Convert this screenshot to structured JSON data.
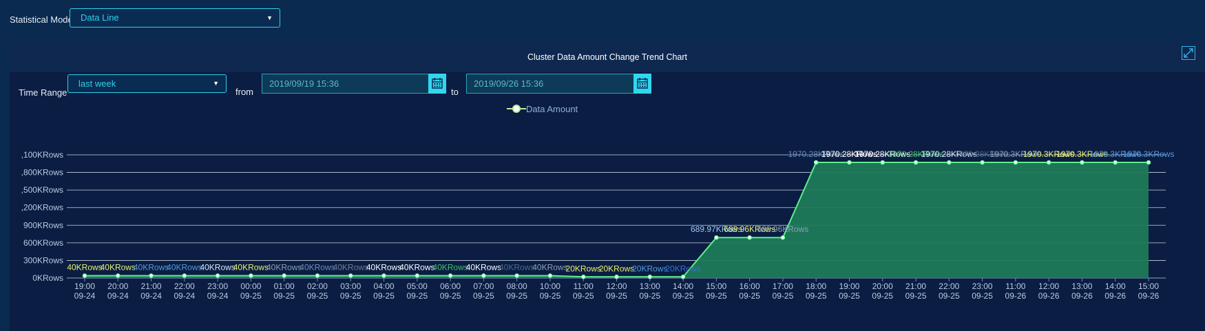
{
  "top": {
    "mode_label": "Statistical Mode",
    "mode_value": "Data Line"
  },
  "panel": {
    "title": "Cluster Data Amount Change Trend Chart",
    "time_range_label": "Time Range",
    "time_range_value": "last week",
    "from_label": "from",
    "from_value": "2019/09/19 15:36",
    "to_label": "to",
    "to_value": "2019/09/26 15:36"
  },
  "chart_data": {
    "type": "area",
    "legend": [
      "Data Amount"
    ],
    "legend_position": "top-center",
    "grid": true,
    "y_tick_labels": [
      "0KRows",
      "300KRows",
      "600KRows",
      "900KRows",
      ",200KRows",
      ",500KRows",
      ",800KRows",
      ",100KRows"
    ],
    "x_labels": [
      [
        "19:00",
        "09-24"
      ],
      [
        "20:00",
        "09-24"
      ],
      [
        "21:00",
        "09-24"
      ],
      [
        "22:00",
        "09-24"
      ],
      [
        "23:00",
        "09-24"
      ],
      [
        "00:00",
        "09-25"
      ],
      [
        "01:00",
        "09-25"
      ],
      [
        "02:00",
        "09-25"
      ],
      [
        "03:00",
        "09-25"
      ],
      [
        "04:00",
        "09-25"
      ],
      [
        "05:00",
        "09-25"
      ],
      [
        "06:00",
        "09-25"
      ],
      [
        "07:00",
        "09-25"
      ],
      [
        "08:00",
        "09-25"
      ],
      [
        "10:00",
        "09-25"
      ],
      [
        "11:00",
        "09-25"
      ],
      [
        "12:00",
        "09-25"
      ],
      [
        "13:00",
        "09-25"
      ],
      [
        "14:00",
        "09-25"
      ],
      [
        "15:00",
        "09-25"
      ],
      [
        "16:00",
        "09-25"
      ],
      [
        "17:00",
        "09-25"
      ],
      [
        "18:00",
        "09-25"
      ],
      [
        "19:00",
        "09-25"
      ],
      [
        "20:00",
        "09-25"
      ],
      [
        "21:00",
        "09-25"
      ],
      [
        "22:00",
        "09-25"
      ],
      [
        "23:00",
        "09-25"
      ],
      [
        "11:00",
        "09-26"
      ],
      [
        "12:00",
        "09-26"
      ],
      [
        "13:00",
        "09-26"
      ],
      [
        "14:00",
        "09-26"
      ],
      [
        "15:00",
        "09-26"
      ]
    ],
    "ylim": [
      0,
      2100
    ],
    "values": [
      40,
      40,
      40,
      40,
      40,
      40,
      40,
      40,
      40,
      40,
      40,
      40,
      40,
      40,
      40,
      20,
      20,
      20,
      20,
      689.97,
      689.96,
      689.96,
      1970.28,
      1970.28,
      1970.28,
      1970.28,
      1970.28,
      1970.28,
      1970.3,
      1970.3,
      1970.3,
      1970.3,
      1970.3
    ],
    "data_labels": [
      "40KRows",
      "40KRows",
      "40KRows",
      "40KRows",
      "40KRows",
      "40KRows",
      "40KRows",
      "40KRows",
      "40KRows",
      "40KRows",
      "40KRows",
      "40KRows",
      "40KRows",
      "40KRows",
      "40KRows",
      "20KRows",
      "20KRows",
      "20KRows",
      "20KRows",
      "689.97KRows",
      "689.96KRows",
      "689.96KRows",
      "1970.28KRows",
      "1970.28KRows",
      "1970.28KRows",
      "1970.28KRows",
      "1970.28KRows",
      "1970.28KRows",
      "1970.3KRows",
      "1970.3KRows",
      "1970.3KRows",
      "1970.3KRows",
      "1970.3KRows"
    ],
    "label_colors": [
      "#e8f070",
      "#e8f070",
      "#4f9be0",
      "#4f9be0",
      "#d8e6f5",
      "#e8f070",
      "#8aa0b8",
      "#6a8fb8",
      "#6a7f96",
      "#ffffff",
      "#ffffff",
      "#40c070",
      "#ffffff",
      "#4a6a8a",
      "#8aa0b8",
      "#e8f070",
      "#e8f070",
      "#4f9be0",
      "#3a6fd0",
      "#9ec9f0",
      "#e8f070",
      "#8aa0b8",
      "#6a8fb8",
      "#ffffff",
      "#ffffff",
      "#40c070",
      "#d8e6f5",
      "#4a6a8a",
      "#8aa0b8",
      "#e8f070",
      "#e8f070",
      "#4f9be0",
      "#4f9be0"
    ],
    "line_color": "#5ef08a",
    "fill_color": "#1f7a5a"
  }
}
